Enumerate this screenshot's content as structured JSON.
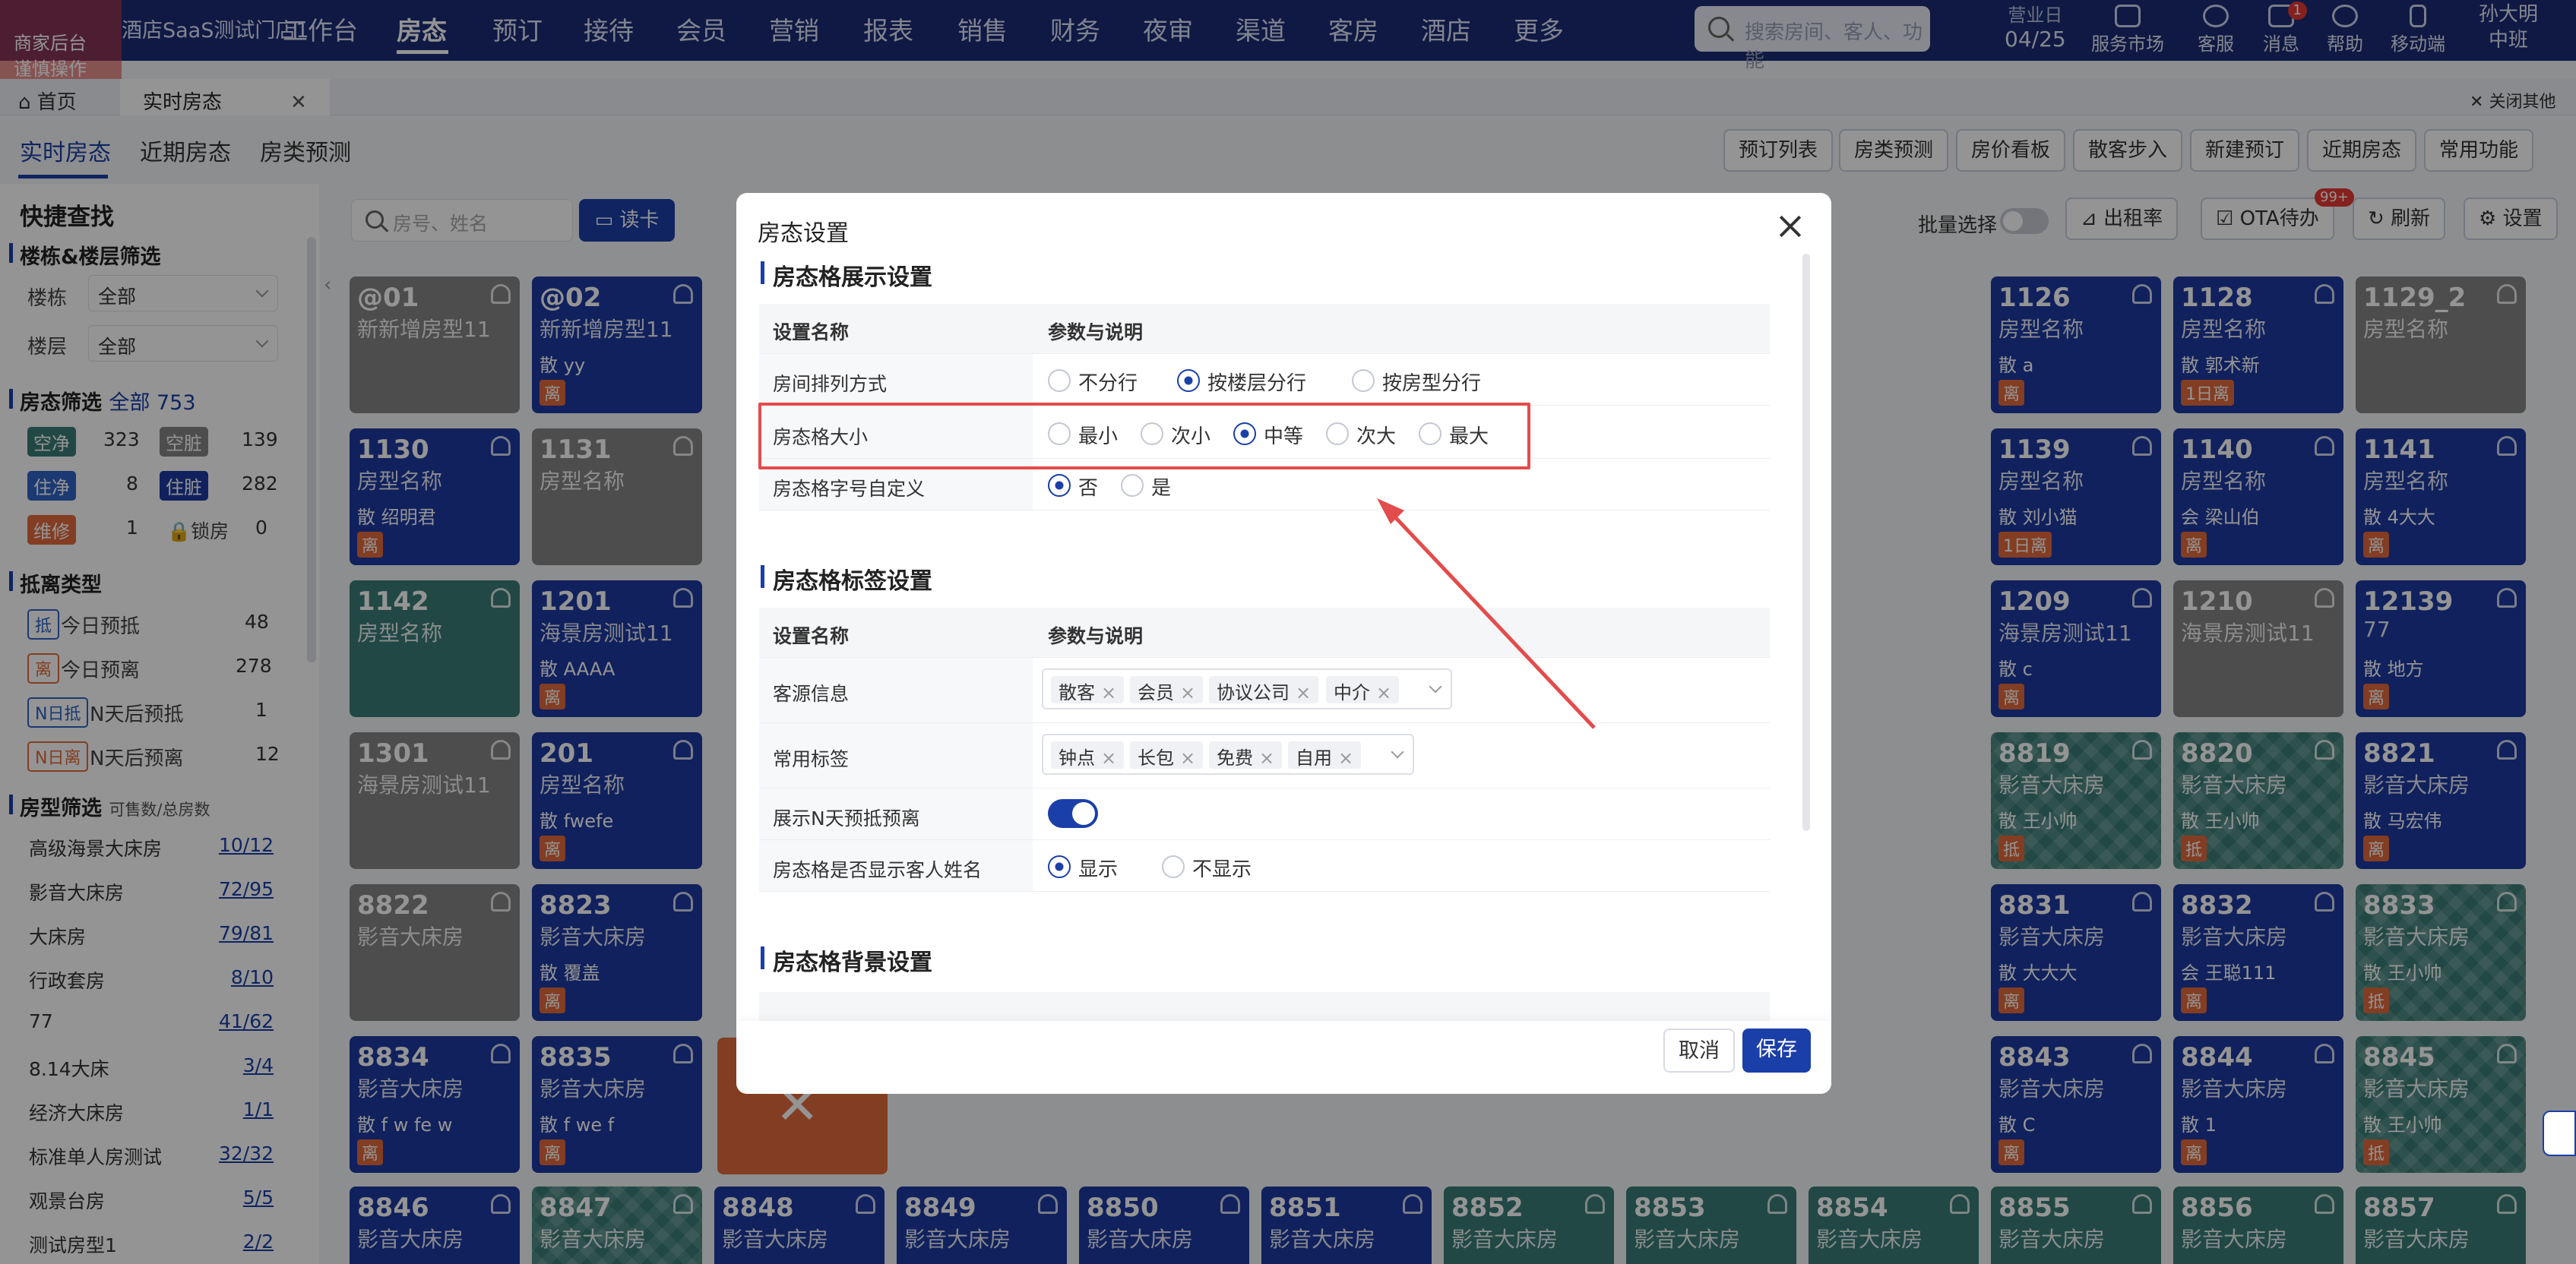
{
  "topnav": {
    "store": "酒店SaaS测试门店1",
    "items": [
      "工作台",
      "房态",
      "预订",
      "接待",
      "会员",
      "营销",
      "报表",
      "销售",
      "财务",
      "夜审",
      "渠道",
      "客房",
      "酒店",
      "更多"
    ],
    "search_placeholder": "搜索房间、客人、功能",
    "bizday_label": "营业日",
    "bizday": "04/25",
    "market": "服务市场",
    "service": "客服",
    "msg": "消息",
    "msg_count": "1",
    "help": "帮助",
    "mobile": "移动端",
    "user": "孙大明",
    "shift": "中班"
  },
  "merchant": {
    "line1": "商家后台",
    "line2": "谨慎操作"
  },
  "tabs": {
    "home": "首页",
    "current": "实时房态",
    "close_all": "关闭其他"
  },
  "subtabs": [
    "实时房态",
    "近期房态",
    "房类预测"
  ],
  "toolbar": [
    "预订列表",
    "房类预测",
    "房价看板",
    "散客步入",
    "新建预订",
    "近期房态",
    "常用功能"
  ],
  "toolbar2": {
    "search_placeholder": "房号、姓名",
    "read_card": "读卡",
    "batch": "批量选择",
    "occupancy": "出租率",
    "ota": "OTA待办",
    "ota_badge": "99+",
    "refresh": "刷新",
    "settings": "设置"
  },
  "left": {
    "title": "快捷查找",
    "building_sec": "楼栋&楼层筛选",
    "building_lbl": "楼栋",
    "building_val": "全部",
    "floor_lbl": "楼层",
    "floor_val": "全部",
    "status_sec": "房态筛选",
    "status_all": "全部 753",
    "status": [
      {
        "label": "空净",
        "count": "323"
      },
      {
        "label": "空脏",
        "count": "139"
      },
      {
        "label": "住净",
        "count": "8"
      },
      {
        "label": "住脏",
        "count": "282"
      },
      {
        "label": "维修",
        "count": "1"
      },
      {
        "label": "锁房",
        "count": "0"
      }
    ],
    "arrive_sec": "抵离类型",
    "arrive": [
      {
        "tag": "抵",
        "label": "今日预抵",
        "count": "48"
      },
      {
        "tag": "离",
        "label": "今日预离",
        "count": "278"
      },
      {
        "tag": "N日抵",
        "label": "N天后预抵",
        "count": "1"
      },
      {
        "tag": "N日离",
        "label": "N天后预离",
        "count": "12"
      }
    ],
    "roomtype_sec": "房型筛选",
    "roomtype_hint": "可售数/总房数",
    "roomtypes": [
      {
        "name": "高级海景大床房",
        "v": "10/12"
      },
      {
        "name": "影音大床房",
        "v": "72/95"
      },
      {
        "name": "大床房",
        "v": "79/81"
      },
      {
        "name": "行政套房",
        "v": "8/10"
      },
      {
        "name": "77",
        "v": "41/62"
      },
      {
        "name": "8.14大床",
        "v": "3/4"
      },
      {
        "name": "经济大床房",
        "v": "1/1"
      },
      {
        "name": "标准单人房测试",
        "v": "32/32"
      },
      {
        "name": "观景台房",
        "v": "5/5"
      },
      {
        "name": "测试房型1",
        "v": "2/2"
      }
    ]
  },
  "rooms": [
    {
      "no": "@01",
      "type": "新新增房型11",
      "guest": "",
      "tag": "",
      "c": "gray"
    },
    {
      "no": "@02",
      "type": "新新增房型11",
      "guest": "散 yy",
      "tag": "离",
      "c": "blue"
    },
    {
      "no": "1130",
      "type": "房型名称",
      "guest": "散 绍明君",
      "tag": "离",
      "c": "blue"
    },
    {
      "no": "1131",
      "type": "房型名称",
      "guest": "",
      "tag": "",
      "c": "gray"
    },
    {
      "no": "1142",
      "type": "房型名称",
      "guest": "",
      "tag": "",
      "c": "teal"
    },
    {
      "no": "1201",
      "type": "海景房测试11",
      "guest": "散 AAAA",
      "tag": "离",
      "c": "blue"
    },
    {
      "no": "1301",
      "type": "海景房测试11",
      "guest": "",
      "tag": "",
      "c": "gray"
    },
    {
      "no": "201",
      "type": "房型名称",
      "guest": "散 fwefe",
      "tag": "离",
      "c": "blue"
    },
    {
      "no": "8822",
      "type": "影音大床房",
      "guest": "",
      "tag": "",
      "c": "gray"
    },
    {
      "no": "8823",
      "type": "影音大床房",
      "guest": "散 覆盖",
      "tag": "离",
      "c": "blue"
    },
    {
      "no": "8834",
      "type": "影音大床房",
      "guest": "散 f w fe w",
      "tag": "离",
      "c": "blue"
    },
    {
      "no": "8835",
      "type": "影音大床房",
      "guest": "散 f we f",
      "tag": "离",
      "c": "blue"
    },
    {
      "no": "8846",
      "type": "影音大床房",
      "guest": "",
      "tag": "",
      "c": "blue"
    },
    {
      "no": "8847",
      "type": "影音大床房",
      "guest": "",
      "tag": "",
      "c": "check"
    },
    {
      "no": "8848",
      "type": "影音大床房",
      "guest": "",
      "tag": "",
      "c": "blue"
    },
    {
      "no": "8849",
      "type": "影音大床房",
      "guest": "",
      "tag": "",
      "c": "blue"
    },
    {
      "no": "8850",
      "type": "影音大床房",
      "guest": "",
      "tag": "",
      "c": "blue"
    },
    {
      "no": "8851",
      "type": "影音大床房",
      "guest": "",
      "tag": "",
      "c": "blue"
    },
    {
      "no": "8852",
      "type": "影音大床房",
      "guest": "",
      "tag": "",
      "c": "teal"
    },
    {
      "no": "8853",
      "type": "影音大床房",
      "guest": "",
      "tag": "",
      "c": "teal"
    },
    {
      "no": "8854",
      "type": "影音大床房",
      "guest": "",
      "tag": "",
      "c": "teal"
    },
    {
      "no": "8855",
      "type": "影音大床房",
      "guest": "",
      "tag": "",
      "c": "teal"
    },
    {
      "no": "8856",
      "type": "影音大床房",
      "guest": "",
      "tag": "",
      "c": "teal"
    },
    {
      "no": "8857",
      "type": "影音大床房",
      "guest": "",
      "tag": "",
      "c": "teal"
    },
    {
      "no": "1126",
      "type": "房型名称",
      "guest": "散 a",
      "tag": "离",
      "c": "blue"
    },
    {
      "no": "1128",
      "type": "房型名称",
      "guest": "散 郭术新",
      "tag": "1日离",
      "c": "blue"
    },
    {
      "no": "1129_2",
      "type": "房型名称",
      "guest": "",
      "tag": "",
      "c": "gray"
    },
    {
      "no": "1139",
      "type": "房型名称",
      "guest": "散 刘小猫",
      "tag": "1日离",
      "c": "blue"
    },
    {
      "no": "1140",
      "type": "房型名称",
      "guest": "会 梁山伯",
      "tag": "离",
      "c": "blue"
    },
    {
      "no": "1141",
      "type": "房型名称",
      "guest": "散 4大大",
      "tag": "离",
      "c": "blue"
    },
    {
      "no": "1209",
      "type": "海景房测试11",
      "guest": "散 c",
      "tag": "离",
      "c": "blue"
    },
    {
      "no": "1210",
      "type": "海景房测试11",
      "guest": "",
      "tag": "",
      "c": "gray"
    },
    {
      "no": "12139",
      "type": "77",
      "guest": "散 地方",
      "tag": "离",
      "c": "blue"
    },
    {
      "no": "8819",
      "type": "影音大床房",
      "guest": "散 王小帅",
      "tag": "抵",
      "c": "check"
    },
    {
      "no": "8820",
      "type": "影音大床房",
      "guest": "散 王小帅",
      "tag": "抵",
      "c": "check"
    },
    {
      "no": "8821",
      "type": "影音大床房",
      "guest": "散 马宏伟",
      "tag": "离",
      "c": "blue"
    },
    {
      "no": "8831",
      "type": "影音大床房",
      "guest": "散 大大大",
      "tag": "离",
      "c": "blue"
    },
    {
      "no": "8832",
      "type": "影音大床房",
      "guest": "会 王聪111",
      "tag": "离",
      "c": "blue"
    },
    {
      "no": "8833",
      "type": "影音大床房",
      "guest": "散 王小帅",
      "tag": "抵",
      "c": "check"
    },
    {
      "no": "8843",
      "type": "影音大床房",
      "guest": "散 C",
      "tag": "离",
      "c": "blue"
    },
    {
      "no": "8844",
      "type": "影音大床房",
      "guest": "散 1",
      "tag": "离",
      "c": "blue"
    },
    {
      "no": "8845",
      "type": "影音大床房",
      "guest": "散 王小帅",
      "tag": "抵",
      "c": "check"
    }
  ],
  "modal": {
    "title": "房态设置",
    "s1": "房态格展示设置",
    "col_name": "设置名称",
    "col_param": "参数与说明",
    "r1_name": "房间排列方式",
    "r1_opts": [
      "不分行",
      "按楼层分行",
      "按房型分行"
    ],
    "r2_name": "房态格大小",
    "r2_opts": [
      "最小",
      "次小",
      "中等",
      "次大",
      "最大"
    ],
    "r3_name": "房态格字号自定义",
    "r3_opts": [
      "否",
      "是"
    ],
    "s2": "房态格标签设置",
    "r4_name": "客源信息",
    "r4_tags": [
      "散客",
      "会员",
      "协议公司",
      "中介"
    ],
    "r5_name": "常用标签",
    "r5_tags": [
      "钟点",
      "长包",
      "免费",
      "自用"
    ],
    "r6_name": "展示N天预抵预离",
    "r7_name": "房态格是否显示客人姓名",
    "r7_opts": [
      "显示",
      "不显示"
    ],
    "s3": "房态格背景设置",
    "cancel": "取消",
    "save": "保存"
  }
}
